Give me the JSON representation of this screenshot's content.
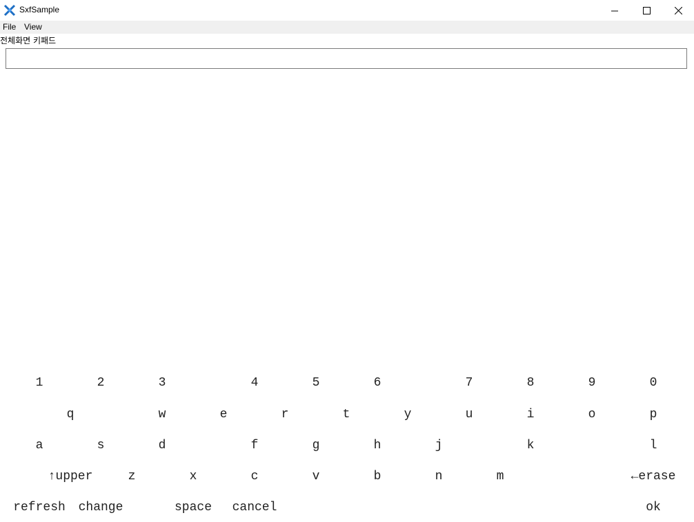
{
  "window": {
    "title": "SxfSample",
    "icon": "app-logo-icon",
    "controls": [
      "minimize-icon",
      "maximize-icon",
      "close-icon"
    ]
  },
  "menu": {
    "file": "File",
    "view": "View"
  },
  "label": "전체화면 키패드",
  "input": {
    "value": "",
    "placeholder": ""
  },
  "keyboard": {
    "row1": [
      "1",
      "2",
      "3",
      "4",
      "5",
      "6",
      "7",
      "8",
      "9",
      "0"
    ],
    "row2": [
      "q",
      "w",
      "e",
      "r",
      "t",
      "y",
      "u",
      "i",
      "o",
      "p"
    ],
    "row3": [
      "a",
      "s",
      "d",
      "f",
      "g",
      "h",
      "j",
      "k",
      "l"
    ],
    "row4": [
      "↑upper",
      "z",
      "x",
      "c",
      "v",
      "b",
      "n",
      "m",
      "←erase"
    ],
    "row5": [
      "refresh",
      "change",
      "space",
      "cancel",
      "ok"
    ]
  }
}
